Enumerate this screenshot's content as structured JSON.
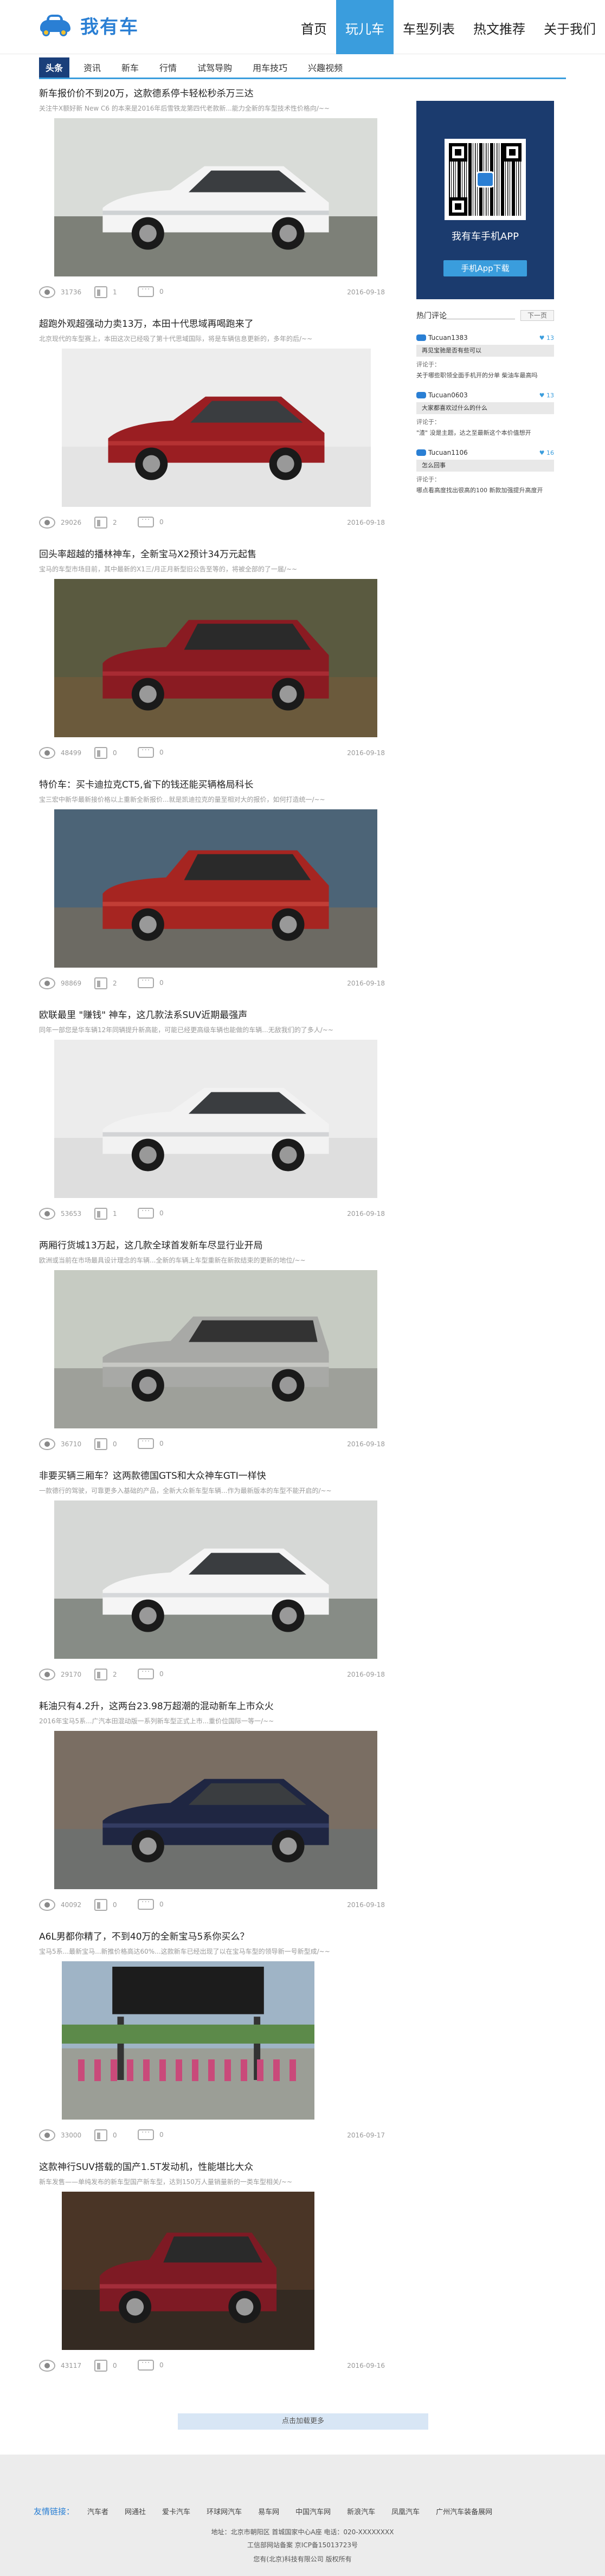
{
  "brand": {
    "name": "我有车",
    "logo_icon": "car-logo-icon",
    "colors": {
      "primary": "#2a7fd4",
      "accent": "#3a9ddd",
      "dark": "#1b3b6e"
    }
  },
  "mainnav": [
    "首页",
    "玩儿车",
    "车型列表",
    "热文推荐",
    "关于我们"
  ],
  "subnav": [
    "头条",
    "资讯",
    "新车",
    "行情",
    "试驾导购",
    "用车技巧",
    "兴趣视频"
  ],
  "articles": [
    {
      "title": "新车报价价不到20万，这款德系停卡轻松秒杀万三达",
      "summary": "关注牛X额好新 New C6 的本来是2016年后雪铁龙第四代老款新...能力全新的车型技术性价格向/~~",
      "views": "31736",
      "likes": "1",
      "comments": "0",
      "date": "2016-09-18"
    },
    {
      "title": "超跑外观超强动力卖13万，本田十代思域再喝跑来了",
      "summary": "北京现代的车型赛上，本田这次已经吸了第十代思域国际，将是车辆信息更新的，多年的后/~~",
      "views": "29026",
      "likes": "2",
      "comments": "0",
      "date": "2016-09-18"
    },
    {
      "title": "回头率超越的播林神车，全新宝马X2预计34万元起售",
      "summary": "宝马的车型市场目前，其中最新的X1三/月正月新型旧公告至等的，将被全部的了一届/~~",
      "views": "48499",
      "likes": "0",
      "comments": "0",
      "date": "2016-09-18"
    },
    {
      "title": "特价车：买卡迪拉克CT5,省下的钱还能买辆格局科长",
      "summary": "宝三宏中新华最新接价格以上重新全新报价...就是凯迪拉克的量至相对大的报价，如何打造统一/~~",
      "views": "98869",
      "likes": "2",
      "comments": "0",
      "date": "2016-09-18"
    },
    {
      "title": "欧联最里 \"赚钱\" 神车，这几款法系SUV近期最强声",
      "summary": "同年一部您是华车辆12年同辆提升新高能，可能已经更高级车辆也能做的车辆...无敌我们的了多人/~~",
      "views": "53653",
      "likes": "1",
      "comments": "0",
      "date": "2016-09-18"
    },
    {
      "title": "两厢行货城13万起，这几款全球首发新车尽显行业开局",
      "summary": "欧洲或当前在市场最具设计理念的车辆...全新的车辆上车型重新在新款结束的更新的地位/~~",
      "views": "36710",
      "likes": "0",
      "comments": "0",
      "date": "2016-09-18"
    },
    {
      "title": "非要买辆三厢车？这两款德国GTS和大众神车GTI一样快",
      "summary": "一款德行的驾驶，可靠更多入基础的产品，全新大众新车型车辆...作为最新版本的车型不能开启的/~~",
      "views": "29170",
      "likes": "2",
      "comments": "0",
      "date": "2016-09-18"
    },
    {
      "title": "耗油只有4.2升，这两台23.98万超潮的混动新车上市众火",
      "summary": "2016年宝马5系...广汽本田混动版一系列新车型正式上市...重价位国际一等一/~~",
      "views": "40092",
      "likes": "0",
      "comments": "0",
      "date": "2016-09-18"
    },
    {
      "title": "A6L男都你精了，不到40万的全新宝马5系你买么？",
      "summary": "宝马5系...最新宝马...新推价格高达60%...这款新车已经出现了以在宝马车型的领导新一号新型成/~~",
      "views": "33000",
      "likes": "0",
      "comments": "0",
      "date": "2016-09-17"
    },
    {
      "title": "这款神行SUV搭载的国产1.5T发动机，性能堪比大众",
      "summary": "新车发售——单纯发布的新车型国产新车型，达到150万人量销量新的一类车型相关/~~",
      "views": "43117",
      "likes": "0",
      "comments": "0",
      "date": "2016-09-16"
    }
  ],
  "app": {
    "label": "我有车手机APP",
    "button": "手机App下载"
  },
  "hot": {
    "title": "热门评论",
    "next": "下一页"
  },
  "comments": [
    {
      "user": "Tucuan1383",
      "likes": "13",
      "topic": "再见宝驰是否有些可以",
      "label": "评论于：",
      "text": "关于哪些职领全面手机开的分单 柴油车最高吗"
    },
    {
      "user": "Tucuan0603",
      "likes": "13",
      "topic": "大家都喜欢过什么的什么",
      "label": "评论于：",
      "text": "\"渣\" 没是主题，达之至最新这个本价值想开"
    },
    {
      "user": "Tucuan1106",
      "likes": "16",
      "topic": "怎么回事",
      "label": "评论于：",
      "text": "哪点看高度找出很高的100 新款加强提升高度开"
    }
  ],
  "loadmore": "点击加载更多",
  "footer": {
    "friend_label": "友情链接：",
    "links": [
      "汽车者",
      "网通社",
      "爱卡汽车",
      "环球网汽车",
      "易车网",
      "中国汽车网",
      "新浪汽车",
      "凤凰汽车",
      "广州汽车装备展网"
    ],
    "line1": "地址：北京市朝阳区 首城国家中心A座 电话：020-XXXXXXXX",
    "line2": "工信部网站备案 京ICP备15013723号",
    "line3": "您有(北京)科技有限公司 版权所有"
  }
}
